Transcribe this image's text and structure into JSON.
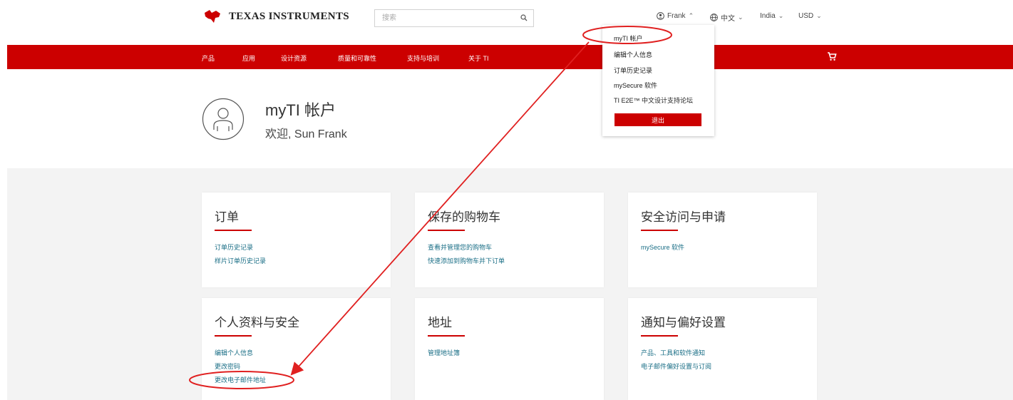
{
  "header": {
    "brand": "Texas Instruments",
    "search_placeholder": "搜索",
    "user_label": "Frank",
    "language_label": "中文",
    "region_label": "India",
    "currency_label": "USD"
  },
  "nav": {
    "items": [
      "产品",
      "应用",
      "设计资源",
      "质量和可靠性",
      "支持与培训",
      "关于 TI"
    ]
  },
  "account_menu": {
    "items": [
      "myTI 帐户",
      "编辑个人信息",
      "订单历史记录",
      "mySecure 软件",
      "TI E2E™ 中文设计支持论坛"
    ],
    "logout_label": "退出"
  },
  "profile": {
    "title": "myTI 帐户",
    "welcome": "欢迎, Sun Frank"
  },
  "cards": [
    {
      "title": "订单",
      "links": [
        "订单历史记录",
        "样片订单历史记录"
      ]
    },
    {
      "title": "保存的购物车",
      "links": [
        "查看并管理您的购物车",
        "快速添加到购物车并下订单"
      ]
    },
    {
      "title": "安全访问与申请",
      "links": [
        "mySecure 软件"
      ]
    },
    {
      "title": "个人资料与安全",
      "links": [
        "编辑个人信息",
        "更改密码",
        "更改电子邮件地址"
      ]
    },
    {
      "title": "地址",
      "links": [
        "管理地址簿"
      ]
    },
    {
      "title": "通知与偏好设置",
      "links": [
        "产品、工具和软件通知",
        "电子邮件偏好设置与订阅"
      ]
    }
  ],
  "colors": {
    "brand_red": "#cc0000",
    "link_teal": "#1a6e86",
    "annotation_red": "#e02020"
  }
}
